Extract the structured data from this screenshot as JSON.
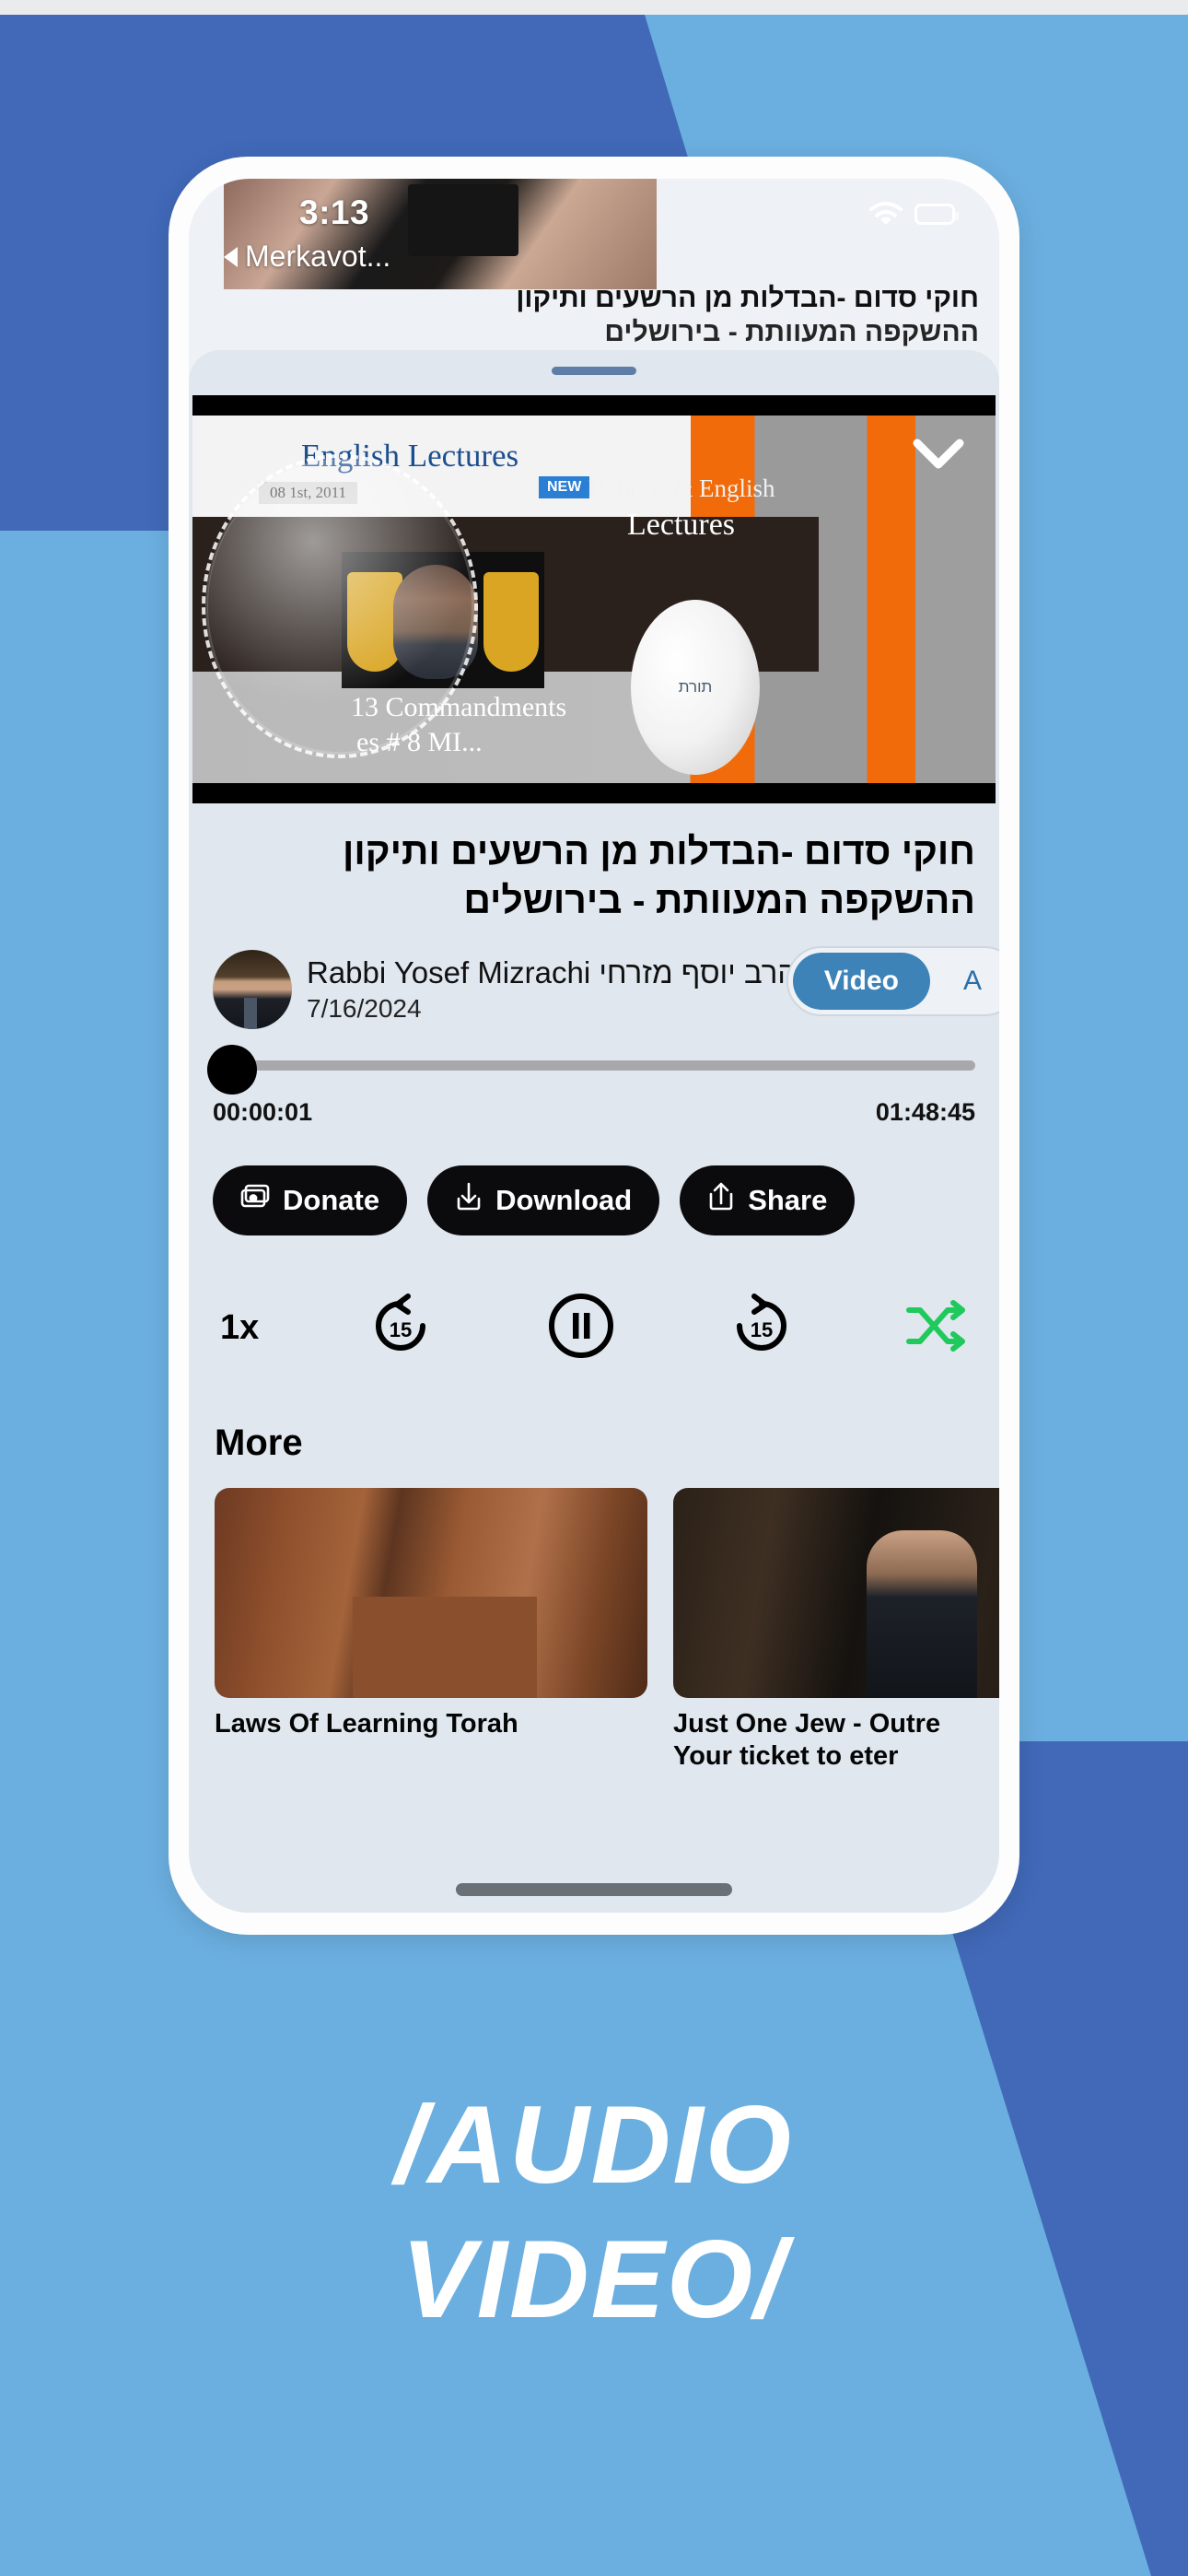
{
  "promo": {
    "line1": "/AUDIO",
    "line2": "VIDEO/",
    "bg_dark": "#4169b8",
    "bg_light": "#6bafe0"
  },
  "status_bar": {
    "time": "3:13",
    "wifi_icon": "wifi-icon",
    "battery_icon": "battery-icon"
  },
  "previous_screen": {
    "back_label": "Merkavot...",
    "back_icon": "back-caret-icon",
    "title_line1": "חוקי סדום -הבדלות מן הרשעים ותיקון",
    "title_line2": "ההשקפה המעוותת - בירושלים"
  },
  "player": {
    "collapse_icon": "chevron-down-icon",
    "video_overlay": {
      "english_lectures": "English Lectures",
      "date_badge": "08 1st, 2011",
      "new_badge": "NEW",
      "hebrew_english": "Hebrew & English",
      "lectures": "Lectures",
      "commandments_line1": "13 Commandments",
      "commandments_line2": "es # 8 MI...",
      "seal_text": "תורת"
    },
    "title": "חוקי סדום -הבדלות מן הרשעים ותיקון ההשקפה המעוותת - בירושלים",
    "author_name": "Rabbi Yosef Mizrachi הרב יוסף מזרחי",
    "date": "7/16/2024",
    "avatar_icon": "avatar",
    "mode_toggle": {
      "options": [
        "Video",
        "Audio"
      ],
      "selected": "Video",
      "audio_partial": "A",
      "active_color": "#3d83b8"
    },
    "progress": {
      "current_time": "00:00:01",
      "total_time": "01:48:45",
      "percent": 1
    },
    "buttons": [
      {
        "label": "Donate",
        "icon": "donate-icon"
      },
      {
        "label": "Download",
        "icon": "download-icon"
      },
      {
        "label": "Share",
        "icon": "share-icon"
      }
    ],
    "transport": {
      "speed_label": "1x",
      "rewind_label": "15",
      "rewind_icon": "rewind-15-icon",
      "play_pause_icon": "pause-icon",
      "forward_label": "15",
      "forward_icon": "forward-15-icon",
      "shuffle_icon": "shuffle-icon",
      "shuffle_color": "#1fc95c"
    }
  },
  "more": {
    "heading": "More",
    "items": [
      {
        "caption": "Laws Of Learning Torah",
        "caption2": ""
      },
      {
        "caption": "Just One Jew - Outre",
        "caption2": "Your ticket to eter"
      }
    ]
  }
}
